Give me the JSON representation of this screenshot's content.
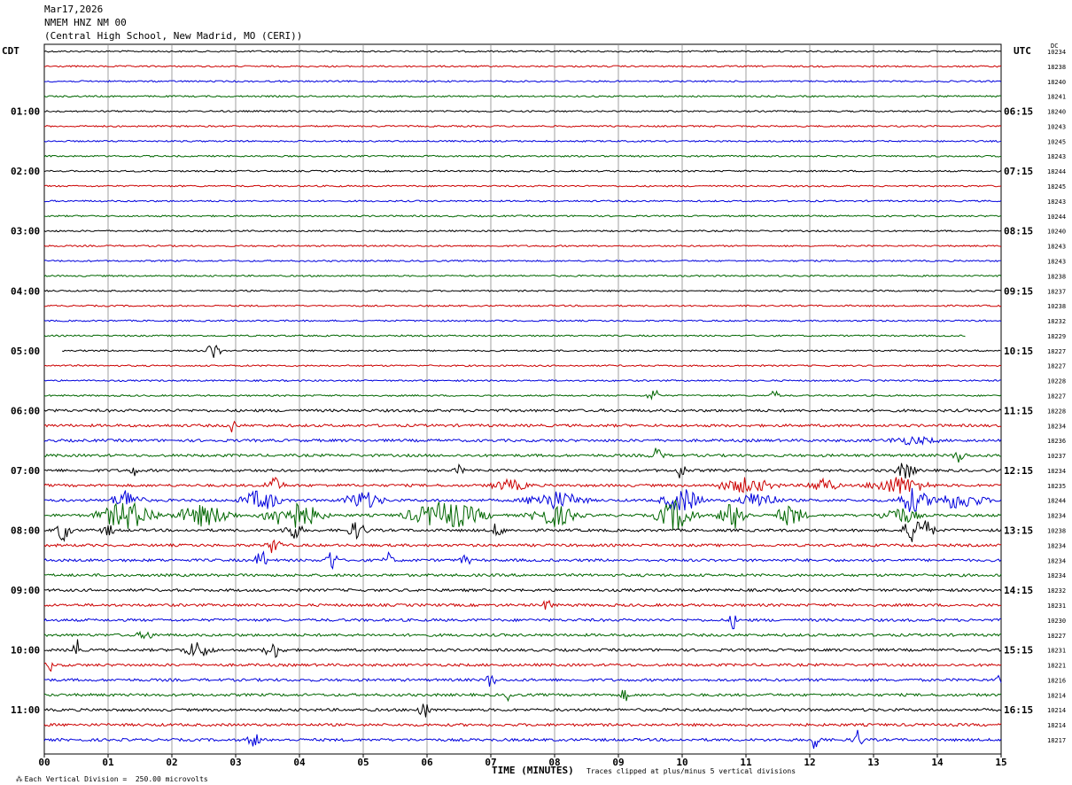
{
  "header": {
    "date": "Mar17,2026",
    "station": "NMEM HNZ NM 00",
    "location": "(Central High School, New Madrid, MO (CERI))"
  },
  "left_tz": "CDT",
  "right_tz": "UTC",
  "dc_label": "DC",
  "footer": {
    "scale": "Each Vertical Division =  250.00 microvolts",
    "clip": "Traces clipped at plus/minus 5 vertical divisions"
  },
  "chart_data": {
    "type": "line",
    "xlabel": "TIME (MINUTES)",
    "x_ticks": [
      "00",
      "01",
      "02",
      "03",
      "04",
      "05",
      "06",
      "07",
      "08",
      "09",
      "10",
      "11",
      "12",
      "13",
      "14",
      "15"
    ],
    "xlim": [
      0,
      15
    ],
    "trace_colors": [
      "#000000",
      "#cc0000",
      "#0000dd",
      "#006600"
    ],
    "hour_labels_left": [
      "01:00",
      "02:00",
      "03:00",
      "04:00",
      "05:00",
      "06:00",
      "07:00",
      "08:00",
      "09:00",
      "10:00",
      "11:00"
    ],
    "hour_labels_right": [
      "06:15",
      "07:15",
      "08:15",
      "09:15",
      "10:15",
      "11:15",
      "12:15",
      "13:15",
      "14:15",
      "15:15",
      "16:15"
    ],
    "dc_values": [
      "10234",
      "18238",
      "18240",
      "18241",
      "18240",
      "10243",
      "10245",
      "18243",
      "18244",
      "18245",
      "18243",
      "10244",
      "10240",
      "18243",
      "18243",
      "18238",
      "18237",
      "10238",
      "18232",
      "18229",
      "18227",
      "18227",
      "10228",
      "18227",
      "18228",
      "18234",
      "18236",
      "10237",
      "18234",
      "18235",
      "18244",
      "18234",
      "10238",
      "18234",
      "18234",
      "18234",
      "18232",
      "18231",
      "10230",
      "18227",
      "18231",
      "18221",
      "18216",
      "18214",
      "10214",
      "18214",
      "18217"
    ]
  }
}
